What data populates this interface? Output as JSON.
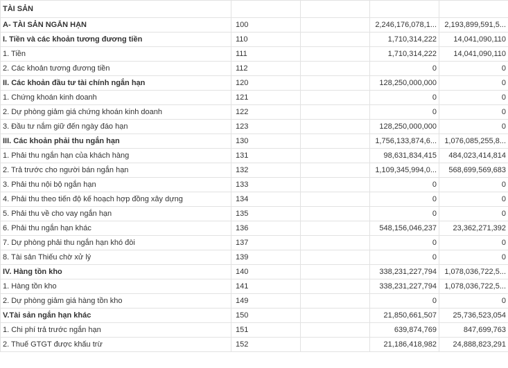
{
  "header": {
    "label": "TÀI SẢN"
  },
  "rows": [
    {
      "name": "A- TÀI SẢN NGẮN HẠN",
      "code": "100",
      "note": "",
      "v1": "2,246,176,078,1...",
      "v2": "2,193,899,591,5...",
      "bold": true
    },
    {
      "name": "I. Tiền và các khoản tương đương tiền",
      "code": "110",
      "note": "",
      "v1": "1,710,314,222",
      "v2": "14,041,090,110",
      "bold": true
    },
    {
      "name": "1. Tiền",
      "code": "111",
      "note": "",
      "v1": "1,710,314,222",
      "v2": "14,041,090,110",
      "bold": false
    },
    {
      "name": "2. Các khoản tương đương tiền",
      "code": "112",
      "note": "",
      "v1": "0",
      "v2": "0",
      "bold": false
    },
    {
      "name": "II. Các khoản đầu tư tài chính ngắn hạn",
      "code": "120",
      "note": "",
      "v1": "128,250,000,000",
      "v2": "0",
      "bold": true
    },
    {
      "name": "1. Chứng khoán kinh doanh",
      "code": "121",
      "note": "",
      "v1": "0",
      "v2": "0",
      "bold": false
    },
    {
      "name": "2. Dự phòng giảm giá chứng khoán kinh doanh",
      "code": "122",
      "note": "",
      "v1": "0",
      "v2": "0",
      "bold": false
    },
    {
      "name": "3. Đầu tư nắm giữ đến ngày đáo hạn",
      "code": "123",
      "note": "",
      "v1": "128,250,000,000",
      "v2": "0",
      "bold": false
    },
    {
      "name": "III. Các khoản phải thu ngắn hạn",
      "code": "130",
      "note": "",
      "v1": "1,756,133,874,6...",
      "v2": "1,076,085,255,8...",
      "bold": true
    },
    {
      "name": "1. Phải thu ngắn hạn của khách hàng",
      "code": "131",
      "note": "",
      "v1": "98,631,834,415",
      "v2": "484,023,414,814",
      "bold": false
    },
    {
      "name": "2. Trả trước cho người bán ngắn hạn",
      "code": "132",
      "note": "",
      "v1": "1,109,345,994,0...",
      "v2": "568,699,569,683",
      "bold": false
    },
    {
      "name": "3. Phải thu nội bộ ngắn hạn",
      "code": "133",
      "note": "",
      "v1": "0",
      "v2": "0",
      "bold": false
    },
    {
      "name": "4. Phải thu theo tiến độ kế hoạch hợp đồng xây dựng",
      "code": "134",
      "note": "",
      "v1": "0",
      "v2": "0",
      "bold": false
    },
    {
      "name": "5. Phải thu về cho vay ngắn hạn",
      "code": "135",
      "note": "",
      "v1": "0",
      "v2": "0",
      "bold": false
    },
    {
      "name": "6. Phải thu ngắn hạn khác",
      "code": "136",
      "note": "",
      "v1": "548,156,046,237",
      "v2": "23,362,271,392",
      "bold": false
    },
    {
      "name": "7. Dự phòng phải thu ngắn hạn khó đòi",
      "code": "137",
      "note": "",
      "v1": "0",
      "v2": "0",
      "bold": false
    },
    {
      "name": "8. Tài sản Thiếu chờ xử lý",
      "code": "139",
      "note": "",
      "v1": "0",
      "v2": "0",
      "bold": false
    },
    {
      "name": "IV. Hàng tồn kho",
      "code": "140",
      "note": "",
      "v1": "338,231,227,794",
      "v2": "1,078,036,722,5...",
      "bold": true
    },
    {
      "name": "1. Hàng tồn kho",
      "code": "141",
      "note": "",
      "v1": "338,231,227,794",
      "v2": "1,078,036,722,5...",
      "bold": false
    },
    {
      "name": "2. Dự phòng giảm giá hàng tồn kho",
      "code": "149",
      "note": "",
      "v1": "0",
      "v2": "0",
      "bold": false
    },
    {
      "name": "V.Tài sản ngắn hạn khác",
      "code": "150",
      "note": "",
      "v1": "21,850,661,507",
      "v2": "25,736,523,054",
      "bold": true
    },
    {
      "name": "1. Chi phí trả trước ngắn hạn",
      "code": "151",
      "note": "",
      "v1": "639,874,769",
      "v2": "847,699,763",
      "bold": false
    },
    {
      "name": "2. Thuế GTGT được khấu trừ",
      "code": "152",
      "note": "",
      "v1": "21,186,418,982",
      "v2": "24,888,823,291",
      "bold": false
    }
  ]
}
